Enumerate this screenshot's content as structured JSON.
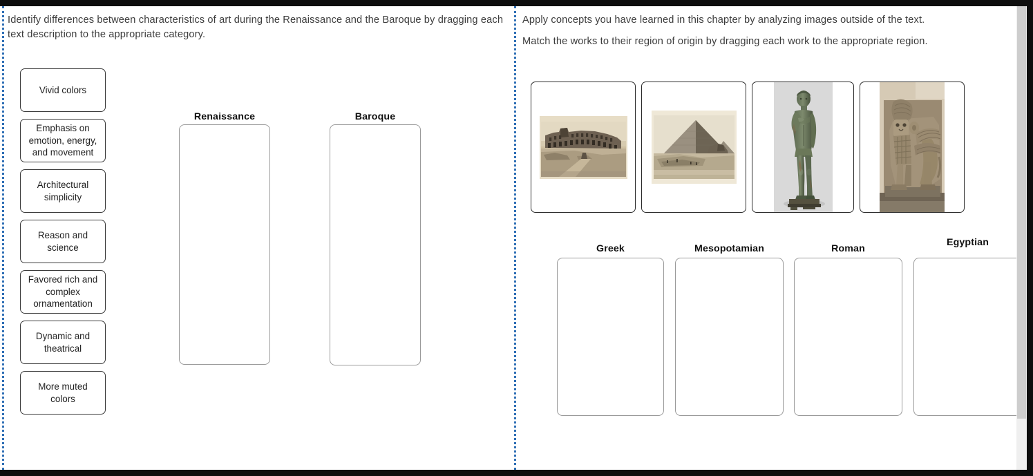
{
  "left_panel": {
    "instruction": "Identify differences between characteristics of art during the Renaissance and the Baroque by dragging each text description to the appropriate category.",
    "draggable_items": [
      {
        "label": "Vivid colors"
      },
      {
        "label": "Emphasis on emotion, energy, and movement"
      },
      {
        "label": "Architectural simplicity"
      },
      {
        "label": "Reason and science"
      },
      {
        "label": "Favored rich and complex ornamentation"
      },
      {
        "label": "Dynamic and theatrical"
      },
      {
        "label": "More muted colors"
      }
    ],
    "drop_zones": [
      {
        "label": "Renaissance",
        "items": []
      },
      {
        "label": "Baroque",
        "items": []
      }
    ]
  },
  "right_panel": {
    "instruction_1": "Apply concepts you have learned in this chapter by analyzing images outside of the text.",
    "instruction_2": "Match the works to their region of origin by dragging each work to the appropriate region.",
    "art_cards": [
      {
        "name": "colosseum-photograph",
        "alt": "Sepia photograph of the Roman Colosseum ruins"
      },
      {
        "name": "pyramid-sphinx-photograph",
        "alt": "Sepia photograph of the Great Pyramid and the Sphinx at Giza"
      },
      {
        "name": "bronze-kouros-statue",
        "alt": "Bronze statue of a standing nude male youth"
      },
      {
        "name": "lamassu-relief",
        "alt": "Stone relief of a winged human-headed bull, a lamassu"
      }
    ],
    "drop_zones": [
      {
        "label": "Greek",
        "items": []
      },
      {
        "label": "Mesopotamian",
        "items": []
      },
      {
        "label": "Roman",
        "items": []
      },
      {
        "label": "Egyptian",
        "items": []
      }
    ]
  },
  "colors": {
    "rail_blue": "#2f6fb5",
    "frame_black": "#0d0d0d",
    "chip_border": "#3a3a3a",
    "dropzone_border": "#9a9a9a",
    "text": "#3c3c3c",
    "scrollbar_track": "#efefef",
    "scrollbar_thumb": "#cdcdcd"
  }
}
